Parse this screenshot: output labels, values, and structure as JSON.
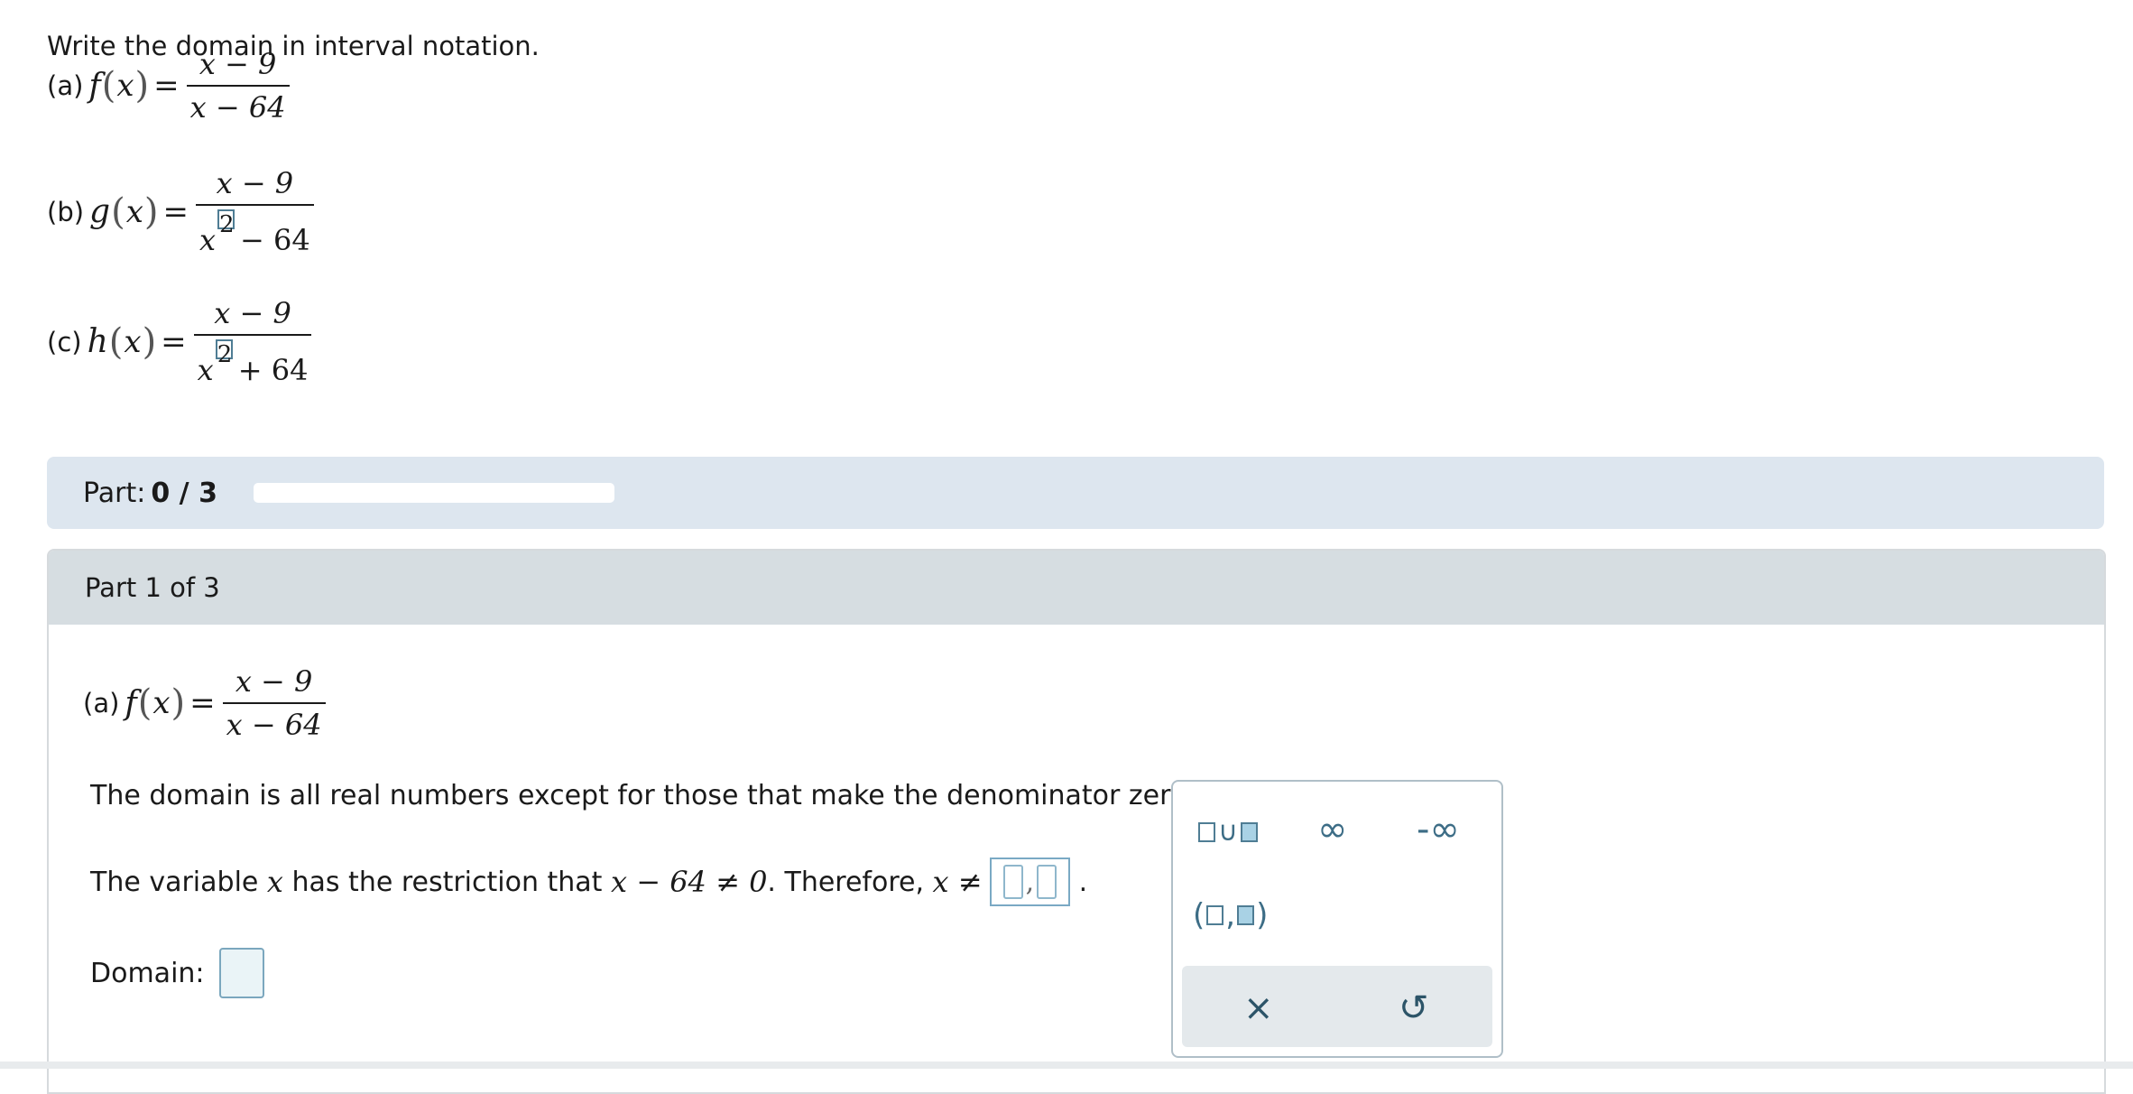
{
  "instructions": "Write the domain in interval notation.",
  "problems": [
    {
      "label": "(a)",
      "fn": "f",
      "var": "x",
      "eq": "=",
      "numerator": "x − 9",
      "denominator": "x − 64"
    },
    {
      "label": "(b)",
      "fn": "g",
      "var": "x",
      "eq": "=",
      "numerator": "x − 9",
      "den_base": "x",
      "den_exp": "2",
      "den_rest": "− 64"
    },
    {
      "label": "(c)",
      "fn": "h",
      "var": "x",
      "eq": "=",
      "numerator": "x − 9",
      "den_base": "x",
      "den_exp": "2",
      "den_rest": "+ 64"
    }
  ],
  "part_progress": {
    "label": "Part:",
    "value": "0 / 3",
    "fraction": 0
  },
  "part_header": "Part 1 of 3",
  "part_problem": {
    "label": "(a)",
    "fn": "f",
    "var": "x",
    "eq": "=",
    "numerator": "x − 9",
    "denominator": "x − 64"
  },
  "explanation": "The domain is all real numbers except for those that make the denominator zero.",
  "restriction": {
    "prefix": "The variable ",
    "var": "x",
    "middle": " has the restriction that ",
    "expr": "x − 64 ≠ 0",
    "after": ". Therefore, ",
    "neq": "x ≠",
    "answer_comma": ",",
    "trailing": " ."
  },
  "domain_label": "Domain:",
  "palette": {
    "union_symbol": "∪",
    "infinity": "∞",
    "neg_infinity": "-∞",
    "interval_open": "(",
    "interval_comma": ",",
    "interval_close": ")",
    "clear": "×",
    "undo": "↺"
  }
}
